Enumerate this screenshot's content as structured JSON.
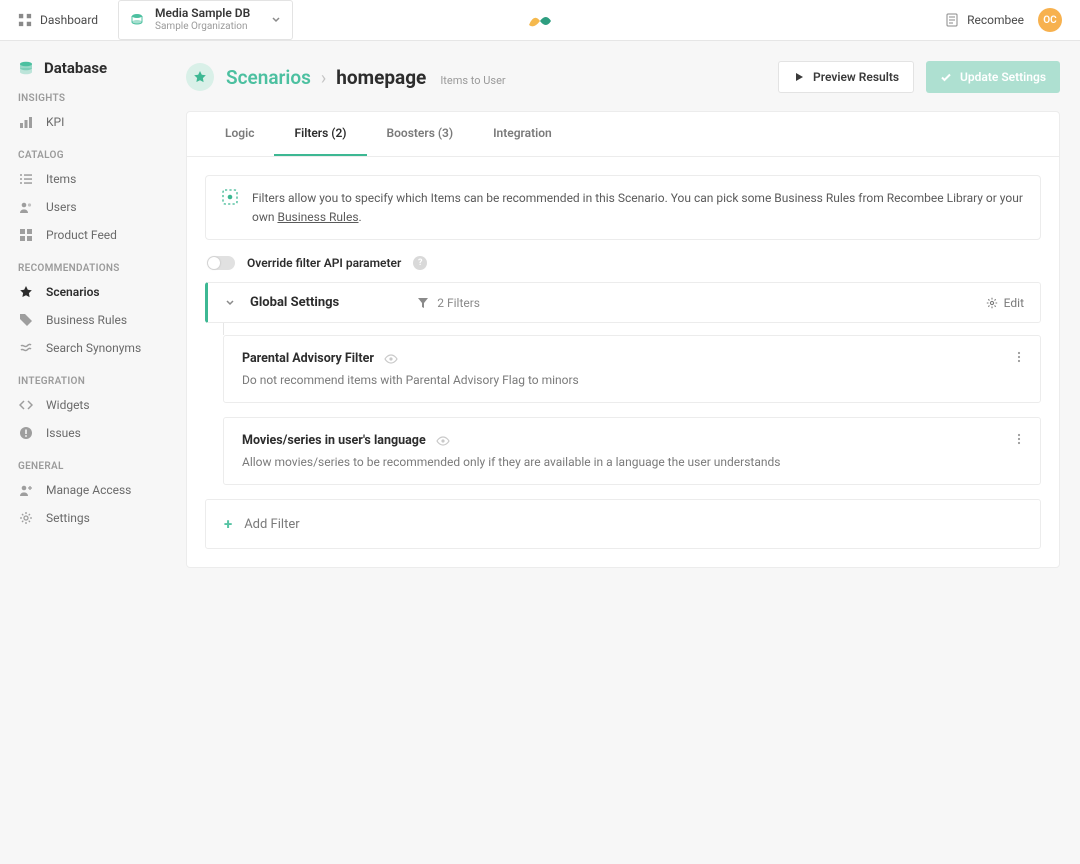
{
  "topbar": {
    "dashboard": "Dashboard",
    "db_name": "Media Sample DB",
    "db_org": "Sample Organization",
    "brand": "Recombee",
    "avatar": "OC"
  },
  "sidebar": {
    "title": "Database",
    "groups": [
      {
        "label": "Insights",
        "items": [
          {
            "id": "kpi",
            "label": "KPI"
          }
        ]
      },
      {
        "label": "Catalog",
        "items": [
          {
            "id": "items",
            "label": "Items"
          },
          {
            "id": "users",
            "label": "Users"
          },
          {
            "id": "product-feed",
            "label": "Product Feed"
          }
        ]
      },
      {
        "label": "Recommendations",
        "items": [
          {
            "id": "scenarios",
            "label": "Scenarios",
            "active": true
          },
          {
            "id": "business-rules",
            "label": "Business Rules"
          },
          {
            "id": "search-synonyms",
            "label": "Search Synonyms"
          }
        ]
      },
      {
        "label": "Integration",
        "items": [
          {
            "id": "widgets",
            "label": "Widgets"
          },
          {
            "id": "issues",
            "label": "Issues"
          }
        ]
      },
      {
        "label": "General",
        "items": [
          {
            "id": "manage-access",
            "label": "Manage Access"
          },
          {
            "id": "settings",
            "label": "Settings"
          }
        ]
      }
    ]
  },
  "header": {
    "breadcrumb_root": "Scenarios",
    "breadcrumb_current": "homepage",
    "meta": "Items to User",
    "preview": "Preview Results",
    "update": "Update Settings"
  },
  "tabs": [
    {
      "id": "logic",
      "label": "Logic"
    },
    {
      "id": "filters",
      "label": "Filters (2)",
      "active": true
    },
    {
      "id": "boosters",
      "label": "Boosters (3)"
    },
    {
      "id": "integration",
      "label": "Integration"
    }
  ],
  "info": {
    "text": "Filters allow you to specify which Items can be recommended in this Scenario. You can pick some Business Rules from Recombee Library or your own ",
    "link": "Business Rules"
  },
  "override": {
    "label": "Override filter API parameter"
  },
  "global": {
    "title": "Global Settings",
    "count": "2 Filters",
    "edit": "Edit"
  },
  "rules": [
    {
      "title": "Parental Advisory Filter",
      "desc": "Do not recommend items with Parental Advisory Flag to minors"
    },
    {
      "title": "Movies/series in user's language",
      "desc": "Allow movies/series to be recommended only if they are available in a language the user understands"
    }
  ],
  "add_filter": "Add Filter"
}
